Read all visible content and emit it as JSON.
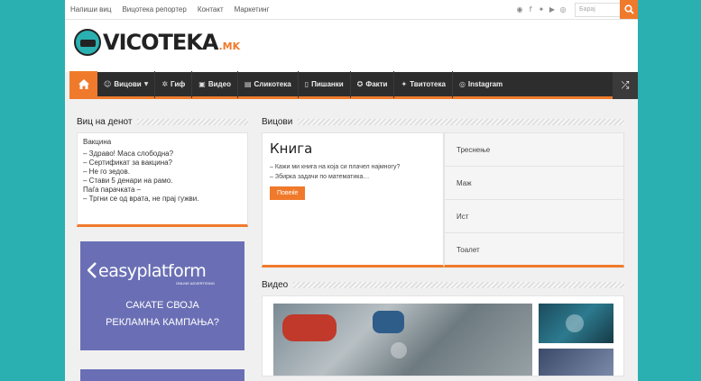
{
  "topbar": {
    "links": [
      "Напиши виц",
      "Вицотека репортер",
      "Контакт",
      "Маркетинг"
    ],
    "search_placeholder": "Барај",
    "social_icons": [
      "rss-icon",
      "facebook-icon",
      "twitter-icon",
      "youtube-icon",
      "instagram-icon"
    ]
  },
  "logo": {
    "name": "VICOTEKA",
    "tld": ".MK"
  },
  "nav": {
    "items": [
      {
        "icon": "smile-icon",
        "label": "Вицови",
        "has_dropdown": true
      },
      {
        "icon": "gear-icon",
        "label": "Гиф"
      },
      {
        "icon": "video-icon",
        "label": "Видео"
      },
      {
        "icon": "image-icon",
        "label": "Сликотека"
      },
      {
        "icon": "document-icon",
        "label": "Пишанки"
      },
      {
        "icon": "facts-icon",
        "label": "Факти"
      },
      {
        "icon": "twitter-icon",
        "label": "Твитотека"
      },
      {
        "icon": "instagram-icon",
        "label": "Instagram"
      }
    ]
  },
  "sidebar": {
    "title": "Виц на денот",
    "joke_title": "Вакцина",
    "joke_lines": [
      "– Здраво! Маса слободна?",
      "– Сертификат за вакцина?",
      "– Не го зедов.",
      "– Стави 5 денари на рамо.",
      "Паѓа парачката –",
      "– Тргни се од врата, не прај гужви."
    ],
    "ad": {
      "brand": "easyplatform",
      "brand_sub": "ONLINE ADVERTISING",
      "line1": "САКАТЕ СВОЈА",
      "line2": "РЕКЛАМНА КАМПАЊА?"
    }
  },
  "main": {
    "vicovi_title": "Вицови",
    "featured": {
      "title": "Книга",
      "lines": [
        "– Кажи ми книга на која си плачел најмногу?",
        "– Збирка задачи по математика…"
      ],
      "more_label": "Повеќе"
    },
    "categories": [
      "Треснење",
      "Маж",
      "Ист",
      "Тоалет"
    ],
    "video_title": "Видео"
  },
  "colors": {
    "accent": "#f07a2b",
    "nav_bg": "#2d2d2d",
    "background": "#2ab0b0"
  }
}
